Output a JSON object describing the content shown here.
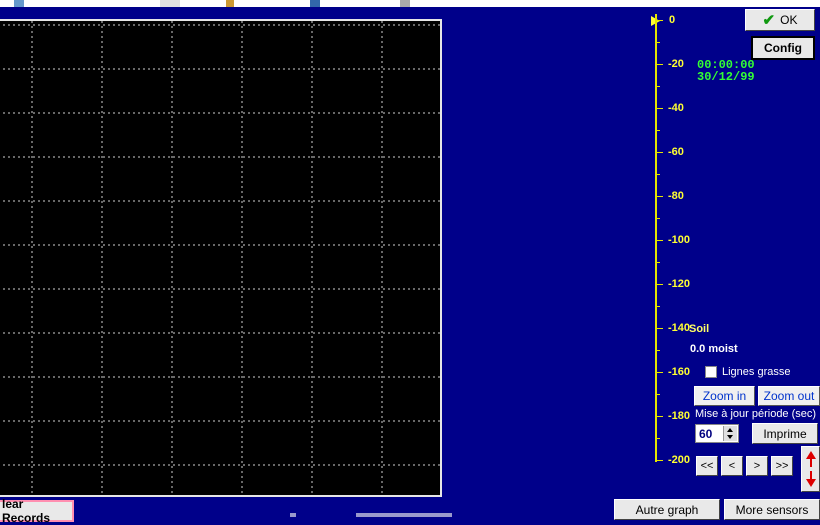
{
  "toolbar": {
    "ok_label": "OK",
    "config_label": "Config"
  },
  "clock": {
    "time": "00:00:00",
    "date": "30/12/99"
  },
  "scale": {
    "labels": [
      "0",
      "-20",
      "-40",
      "-60",
      "-80",
      "-100",
      "-120",
      "-140",
      "-160",
      "-180",
      "-200"
    ]
  },
  "sensor": {
    "name": "Soil",
    "value": "0.0 moist"
  },
  "options": {
    "bold_lines_label": "Lignes grasse",
    "zoom_in_label": "Zoom in",
    "zoom_out_label": "Zoom out",
    "update_period_label": "Mise à jour période (sec)",
    "update_period_value": "60",
    "print_label": "Imprime"
  },
  "nav": {
    "first": "<<",
    "prev": "<",
    "next": ">",
    "last": ">>"
  },
  "bottom": {
    "clear_records_label": "lear Records",
    "other_graph_label": "Autre graph",
    "more_sensors_label": "More sensors"
  },
  "colors": {
    "background": "#00008a",
    "scale": "#e6e600",
    "clock": "#33ff33",
    "grid": "#cfcfcf"
  }
}
